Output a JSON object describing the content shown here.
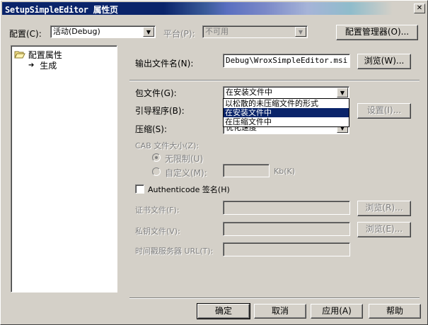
{
  "window": {
    "title": "SetupSimpleEditor 属性页",
    "close_glyph": "✕"
  },
  "toolbar": {
    "config_label": "配置(C):",
    "config_value": "活动(Debug)",
    "platform_label": "平台(P):",
    "platform_value": "不可用",
    "config_manager_button": "配置管理器(O)..."
  },
  "tree": {
    "root_label": "配置属性",
    "child_label": "生成"
  },
  "form": {
    "output_label": "输出文件名(N):",
    "output_value": "Debug\\WroxSimpleEditor.msi",
    "browse_button": "浏览(W)...",
    "package_label": "包文件(G):",
    "package_value": "在安装文件中",
    "package_options": [
      "以松散的未压缩文件的形式",
      "在安装文件中",
      "在压缩文件中"
    ],
    "package_selected_index": 1,
    "bootstrap_label": "引导程序(B):",
    "settings_button": "设置(I)...",
    "compress_label": "压缩(S):",
    "compress_value": "优化速度",
    "cab_label": "CAB 文件大小(Z):",
    "unlimited_label": "无限制(U)",
    "custom_label": "自定义(M):",
    "kb_label": "Kb(K)",
    "authenticode_label": "Authenticode 签名(H)",
    "cert_label": "证书文件(F):",
    "cert_browse_button": "浏览(R)...",
    "key_label": "私钥文件(V):",
    "key_browse_button": "浏览(E)...",
    "timestamp_label": "时间戳服务器 URL(T):"
  },
  "footer": {
    "ok_button": "确定",
    "cancel_button": "取消",
    "apply_button": "应用(A)",
    "help_button": "帮助"
  }
}
